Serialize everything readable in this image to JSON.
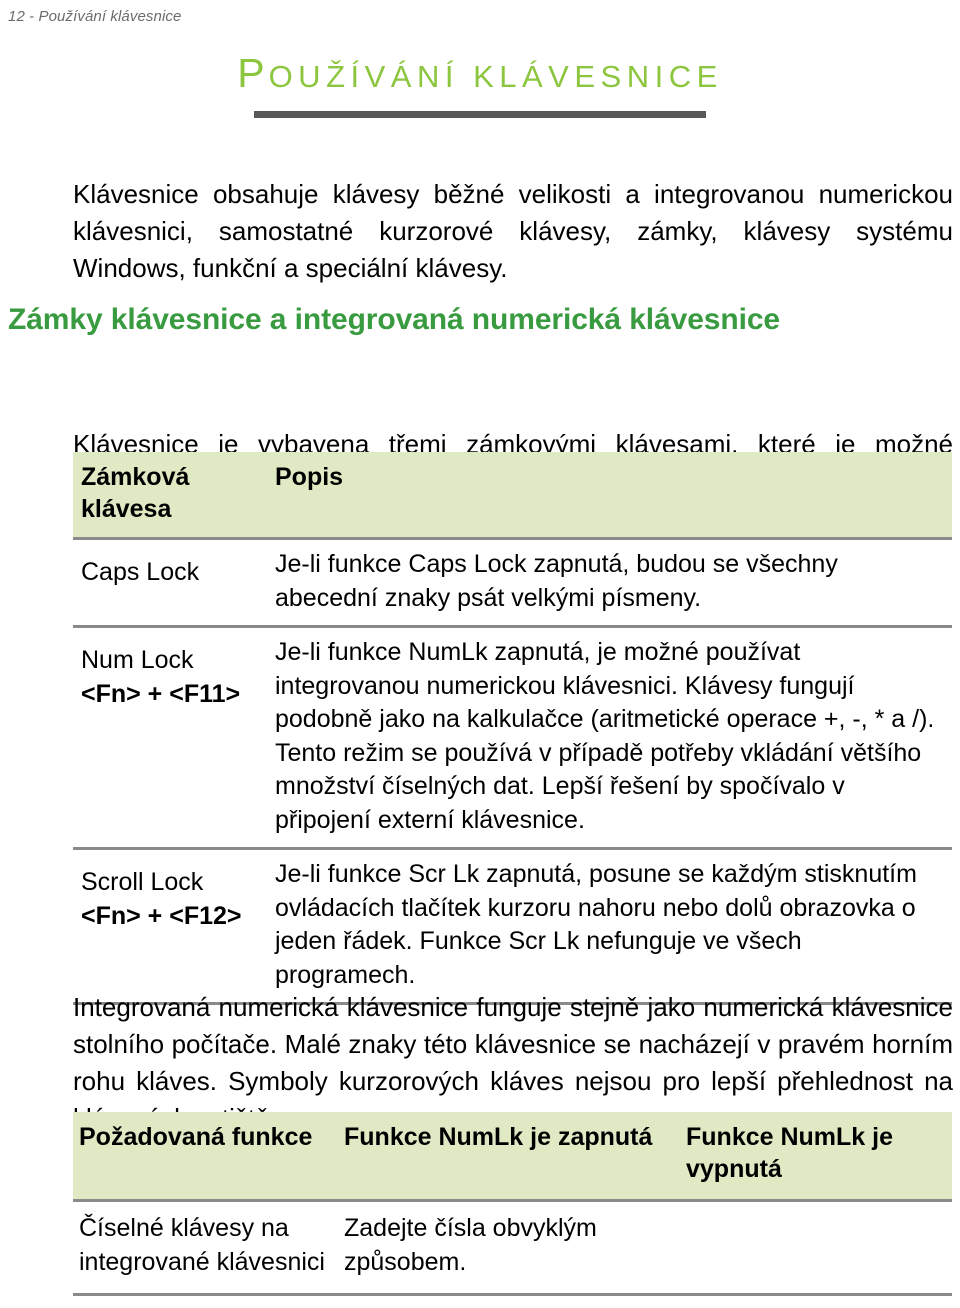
{
  "page": {
    "running_header": "12 - Používání klávesnice",
    "title_first_letter": "P",
    "title_rest": "OUŽÍVÁNÍ KLÁVESNICE",
    "title_color": "#8cc63f",
    "rule_color": "#595959",
    "heading_color": "#389b3f",
    "table_header_bg": "#dfe9c4",
    "table_rule_color": "#8a8a8a"
  },
  "intro": "Klávesnice obsahuje klávesy běžné velikosti a integrovanou numerickou klávesnici, samostatné kurzorové klávesy, zámky, klávesy systému Windows, funkční a speciální klávesy.",
  "section": {
    "heading": "Zámky klávesnice a integrovaná numerická klávesnice",
    "lead": "Klávesnice je vybavena třemi zámkovými klávesami, které je možné přepínat."
  },
  "lock_keys_table": {
    "headers": [
      "Zámková klávesa",
      "Popis"
    ],
    "rows": [
      {
        "key_name": "Caps Lock",
        "key_combo": "",
        "description": "Je-li funkce Caps Lock zapnutá, budou se všechny abecední znaky psát velkými písmeny."
      },
      {
        "key_name": "Num Lock",
        "key_combo": "<Fn> + <F11>",
        "description": "Je-li funkce NumLk zapnutá, je možné používat integrovanou numerickou klávesnici. Klávesy fungují podobně jako na kalkulačce (aritmetické operace +, -, * a /). Tento režim se používá v případě potřeby vkládání většího množství číselných dat. Lepší řešení by spočívalo v připojení externí klávesnice."
      },
      {
        "key_name": "Scroll Lock",
        "key_combo": "<Fn> + <F12>",
        "description": "Je-li funkce Scr Lk zapnutá, posune se každým stisknutím ovládacích tlačítek kurzoru nahoru nebo dolů obrazovka o jeden řádek. Funkce Scr Lk nefunguje ve všech programech."
      }
    ]
  },
  "mid_paragraph": "Integrovaná numerická klávesnice funguje stejně jako numerická klávesnice stolního počítače. Malé znaky této klávesnice se nacházejí v pravém horním rohu kláves. Symboly kurzorových kláves nejsou pro lepší přehlednost na klávesách vytištěny.",
  "numlk_table": {
    "headers": [
      "Požadovaná funkce",
      "Funkce NumLk je zapnutá",
      "Funkce NumLk je vypnutá"
    ],
    "rows": [
      {
        "feature": "Číselné klávesy na integrované klávesnici",
        "on": "Zadejte čísla obvyklým způsobem.",
        "off": ""
      }
    ]
  }
}
